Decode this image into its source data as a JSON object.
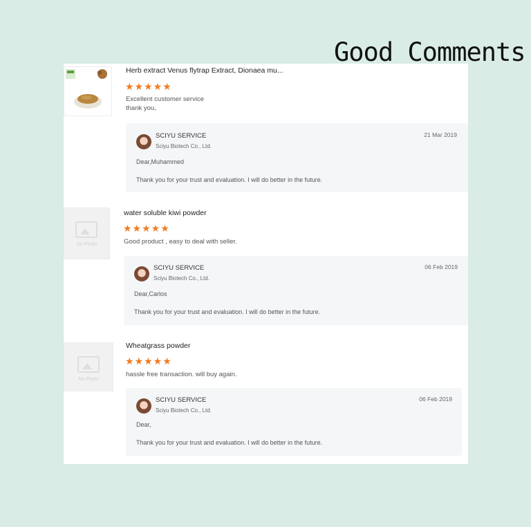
{
  "heading": "Good Comments",
  "reviews": [
    {
      "product": "Herb extract Venus flytrap Extract, Dionaea mu...",
      "stars": "★★★★★",
      "rating": 5,
      "comment_lines": [
        "Excellent customer service",
        "thank you,"
      ],
      "reply": {
        "author": "SCIYU SERVICE",
        "company": "Sciyu Biotech Co., Ltd.",
        "date": "21 Mar 2019",
        "greeting": "Dear,Muhammed",
        "message": "Thank you for your trust and evaluation. I will do better in the future."
      }
    },
    {
      "product": "water soluble kiwi powder",
      "thumb_label": "No Photo",
      "stars": "★★★★★",
      "rating": 5,
      "comment_lines": [
        "Good product , easy to deal with seller."
      ],
      "reply": {
        "author": "SCIYU SERVICE",
        "company": "Sciyu Biotech Co., Ltd.",
        "date": "06 Feb 2019",
        "greeting": "Dear,Carlos",
        "message": "Thank you for your trust and evaluation. I will do better in the future."
      }
    },
    {
      "product": "Wheatgrass powder",
      "thumb_label": "No Photo",
      "stars": "★★★★★",
      "rating": 5,
      "comment_lines": [
        "hassle free transaction. will buy again."
      ],
      "reply": {
        "author": "SCIYU SERVICE",
        "company": "Sciyu Biotech Co., Ltd.",
        "date": "06 Feb 2019",
        "greeting": "Dear,",
        "message": "Thank you for your trust and evaluation. I will do better in the future."
      }
    }
  ]
}
